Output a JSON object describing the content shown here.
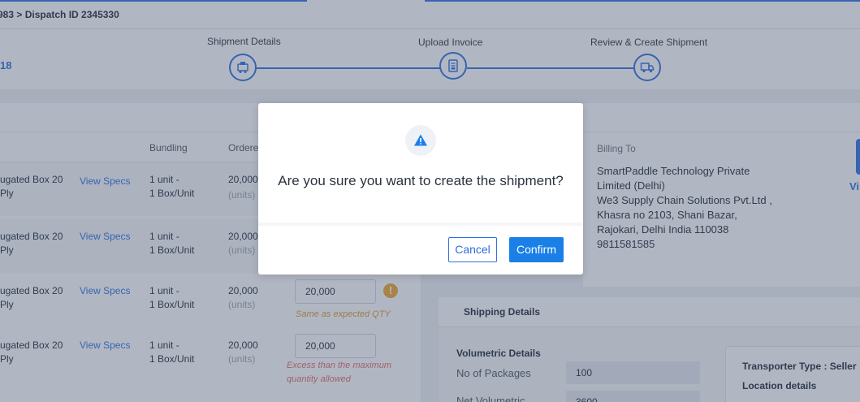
{
  "breadcrumb": {
    "text": "983 > Dispatch ID 2345330"
  },
  "header": {
    "left_code": "18"
  },
  "stepper": {
    "steps": [
      {
        "label": "Shipment Details",
        "icon": "truck-loading-icon"
      },
      {
        "label": "Upload Invoice",
        "icon": "invoice-icon"
      },
      {
        "label": "Review & Create Shipment",
        "icon": "truck-icon"
      }
    ]
  },
  "table": {
    "columns": {
      "bundling": "Bundling",
      "ordered": "Ordere"
    },
    "rows": [
      {
        "item": [
          "ugated Box 20",
          "Ply"
        ],
        "specs_link": "View Specs",
        "bundling": [
          "1 unit -",
          "1 Box/Unit"
        ],
        "ordered_qty": "20,000",
        "ordered_unit": "(units)"
      },
      {
        "item": [
          "ugated Box 20",
          "Ply"
        ],
        "specs_link": "View Specs",
        "bundling": [
          "1 unit -",
          "1 Box/Unit"
        ],
        "ordered_qty": "20,000",
        "ordered_unit": "(units)"
      },
      {
        "item": [
          "ugated Box 20",
          "Ply"
        ],
        "specs_link": "View Specs",
        "bundling": [
          "1 unit -",
          "1 Box/Unit"
        ],
        "ordered_qty": "20,000",
        "ordered_unit": "(units)",
        "input_value": "20,000",
        "hint": "Same as expected QTY"
      },
      {
        "item": [
          "ugated Box 20",
          "Ply"
        ],
        "specs_link": "View Specs",
        "bundling": [
          "1 unit -",
          "1 Box/Unit"
        ],
        "ordered_qty": "20,000",
        "ordered_unit": "(units)",
        "input_value": "20,000",
        "hint": [
          "Excess than the maximum",
          "quantity allowed"
        ]
      }
    ]
  },
  "billing": {
    "label": "Billing To",
    "lines": [
      "SmartPaddle Technology Private",
      "Limited (Delhi)",
      "We3 Supply Chain Solutions Pvt.Ltd ,",
      "Khasra no 2103,  Shani Bazar,",
      "Rajokari, Delhi India 110038",
      "9811581585"
    ],
    "side_link": "Vi"
  },
  "shipping": {
    "title": "Shipping Details",
    "volumetric_title": "Volumetric Details",
    "packages_label": "No of Packages",
    "packages_value": "100",
    "net_vol_label": "Net Volumetric",
    "net_vol_value": "3600",
    "transporter_type": "Transporter Type : Seller",
    "location_details": "Location details"
  },
  "modal": {
    "icon": "warning-triangle-icon",
    "message": "Are you sure you want to create the shipment?",
    "cancel_label": "Cancel",
    "confirm_label": "Confirm"
  },
  "colors": {
    "accent": "#2d6ee0",
    "confirm": "#1a7fe6",
    "warning": "#f0a531",
    "error": "#e26a6a",
    "overlay": "rgba(70,84,110,0.42)"
  }
}
